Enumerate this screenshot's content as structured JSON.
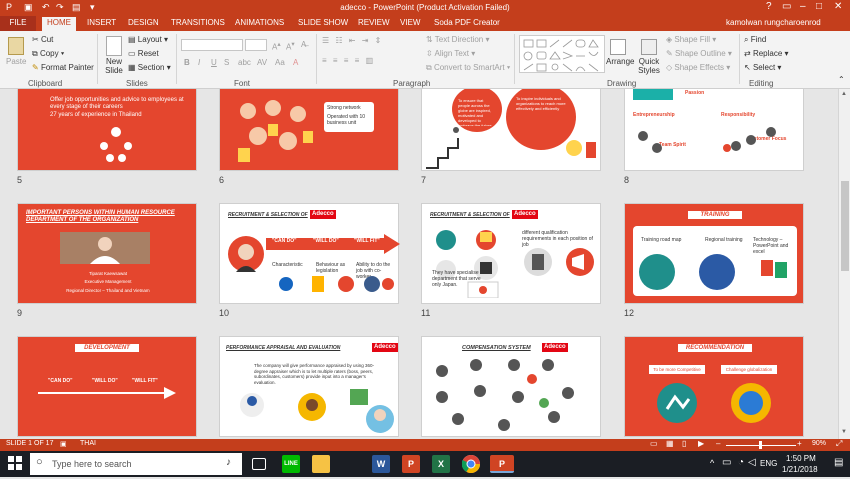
{
  "titlebar": {
    "title": "adecco - PowerPoint (Product Activation Failed)",
    "user": "kamolwan rungcharoenrod"
  },
  "tabs": [
    "FILE",
    "HOME",
    "INSERT",
    "DESIGN",
    "TRANSITIONS",
    "ANIMATIONS",
    "SLIDE SHOW",
    "REVIEW",
    "VIEW",
    "Soda PDF Creator"
  ],
  "ribbon": {
    "clipboard": {
      "paste": "Paste",
      "cut": "Cut",
      "copy": "Copy",
      "format_painter": "Format Painter",
      "label": "Clipboard"
    },
    "slides": {
      "new_slide": "New Slide",
      "layout": "Layout",
      "reset": "Reset",
      "section": "Section",
      "label": "Slides"
    },
    "font": {
      "bold": "B",
      "italic": "I",
      "underline": "U",
      "strike": "S",
      "label": "Font"
    },
    "paragraph": {
      "text_direction": "Text Direction",
      "align_text": "Align Text",
      "convert": "Convert to SmartArt",
      "label": "Paragraph"
    },
    "drawing": {
      "arrange": "Arrange",
      "quick_styles": "Quick Styles",
      "shape_fill": "Shape Fill",
      "shape_outline": "Shape Outline",
      "shape_effects": "Shape Effects",
      "label": "Drawing"
    },
    "editing": {
      "find": "Find",
      "replace": "Replace",
      "select": "Select",
      "label": "Editing"
    }
  },
  "slides": [
    {
      "num": "5",
      "bullets": [
        "Offer job opportunities and advice to employees at every stage of their careers",
        "27 years of experience in Thailand"
      ]
    },
    {
      "num": "6",
      "bullets": [
        "Strong network",
        "Operated with 10 business unit"
      ]
    },
    {
      "num": "7",
      "text1": "To ensure that people across the globe are inspired, motivated and developed to embrace the future of work",
      "text2": "To inspire individuals and organizations to reach more effectively and efficiently"
    },
    {
      "num": "8",
      "items": [
        "Passion",
        "Entrepreneurship",
        "Responsibility",
        "Team Spirit",
        "Customer Focus"
      ]
    },
    {
      "num": "9",
      "title": "IMPORTANT PERSONS WITHIN HUMAN RESOURCE DEPARTMENT OF THE ORGANIZATION",
      "name": "Tiparat Kaewsawat",
      "role": "Executive Management",
      "role2": "Regional Director – Thailand and Vietnam"
    },
    {
      "num": "10",
      "title": "RECRUITMENT & SELECTION OF",
      "logo": "Adecco",
      "labels": [
        "\"CAN DO\"",
        "\"WILL DO\"",
        "\"WILL FIT\""
      ],
      "items": [
        "Characteristic",
        "Behaviour as legislation",
        "Ability to do the job with co-worker"
      ]
    },
    {
      "num": "11",
      "title": "RECRUITMENT & SELECTION OF",
      "logo": "Adecco",
      "items": [
        "different qualification requirements in each position of job",
        "They have specialise department that serve only Japan."
      ]
    },
    {
      "num": "12",
      "title": "TRAINING",
      "items": [
        "Training road map",
        "Regional training",
        "Technology – PowerPoint and excel"
      ]
    },
    {
      "num": "13",
      "title": "DEVELOPMENT",
      "labels": [
        "\"CAN DO\"",
        "\"WILL DO\"",
        "\"WILL FIT\""
      ]
    },
    {
      "num": "14",
      "title": "PERFORMANCE APPRAISAL AND EVALUATION",
      "logo": "Adecco",
      "text": "The company will give performance appraised by using 360-degree appraiser which is to let multiple raters (boss, peers, subordinates, customers) provide input into a manager's evaluation."
    },
    {
      "num": "15",
      "title": "COMPENSATION SYSTEM",
      "logo": "Adecco"
    },
    {
      "num": "16",
      "title": "RECOMMENDATION",
      "items": [
        "To be more Competitive",
        "Challenge globalization"
      ]
    }
  ],
  "statusbar": {
    "slide": "SLIDE 1 OF 17",
    "lang": "THAI",
    "zoom": "90%"
  },
  "taskbar": {
    "search": "Type here to search",
    "lang": "ENG",
    "time": "1:50 PM",
    "date": "1/21/2018"
  }
}
